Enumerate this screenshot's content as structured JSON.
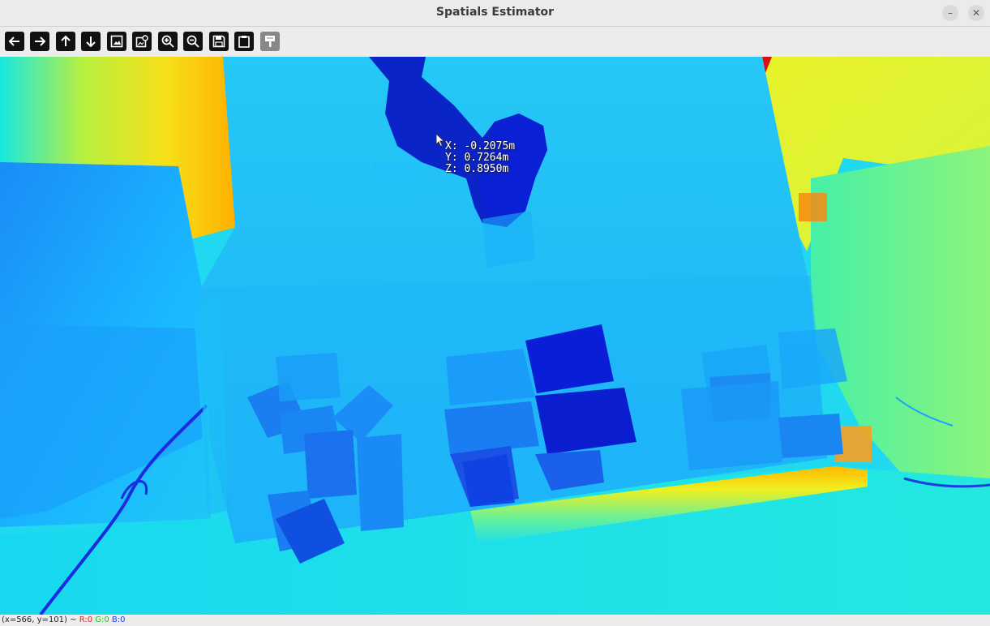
{
  "window": {
    "title": "Spatials Estimator",
    "minimize_symbol": "–",
    "close_symbol": "✕"
  },
  "toolbar": {
    "buttons": [
      {
        "name": "pan-left-button",
        "icon": "arrow-left-icon"
      },
      {
        "name": "pan-right-button",
        "icon": "arrow-right-icon"
      },
      {
        "name": "pan-up-button",
        "icon": "arrow-up-icon"
      },
      {
        "name": "pan-down-button",
        "icon": "arrow-down-icon"
      },
      {
        "name": "zoom-original-button",
        "icon": "image-icon"
      },
      {
        "name": "zoom-fit-button",
        "icon": "image-zoom-icon"
      },
      {
        "name": "zoom-in-button",
        "icon": "zoom-in-icon"
      },
      {
        "name": "zoom-out-button",
        "icon": "zoom-out-icon"
      },
      {
        "name": "save-button",
        "icon": "floppy-icon"
      },
      {
        "name": "copy-button",
        "icon": "clipboard-icon"
      },
      {
        "name": "properties-button",
        "icon": "brush-icon"
      }
    ]
  },
  "readout": {
    "x": "X: -0.2075m",
    "y": "Y: 0.7264m",
    "z": "Z: 0.8950m"
  },
  "status": {
    "coords": "(x=566, y=101) ~",
    "r": "R:0",
    "g": "G:0",
    "b": "B:0"
  },
  "colors": {
    "depth_near": "#0a20d8",
    "depth_mid": "#1fc4ff",
    "depth_far": "#f2f020",
    "depth_farthest": "#ff9a00"
  }
}
